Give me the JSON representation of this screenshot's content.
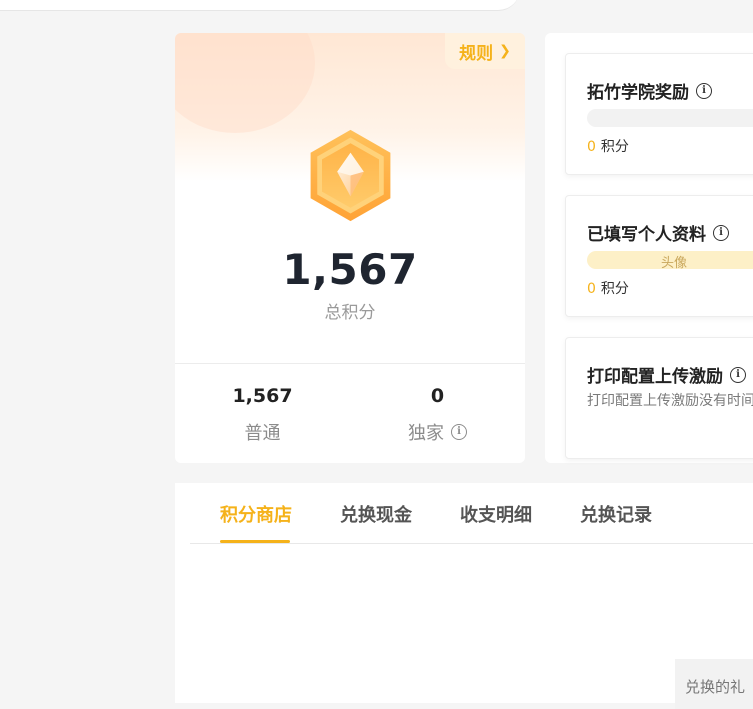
{
  "summary": {
    "rules_label": "规则",
    "total_points": "1,567",
    "total_label": "总积分",
    "normal_points": "1,567",
    "normal_label": "普通",
    "exclusive_points": "0",
    "exclusive_label": "独家"
  },
  "tasks": [
    {
      "title": "拓竹学院奖励",
      "points": "0",
      "points_unit": "积分"
    },
    {
      "title": "已填写个人资料",
      "bar_label": "头像",
      "points": "0",
      "points_unit": "积分"
    },
    {
      "title": "打印配置上传激励",
      "description": "打印配置上传激励没有时间"
    }
  ],
  "tabs": [
    {
      "label": "积分商店",
      "active": true
    },
    {
      "label": "兑换现金",
      "active": false
    },
    {
      "label": "收支明细",
      "active": false
    },
    {
      "label": "兑换记录",
      "active": false
    }
  ],
  "partial_text": "兑换的礼",
  "colors": {
    "accent": "#f5b21a",
    "background": "#f5f5f5",
    "text_dark": "#1f2530"
  },
  "icons": [
    "crystal-badge-icon",
    "chevron-right-icon",
    "info-icon"
  ]
}
